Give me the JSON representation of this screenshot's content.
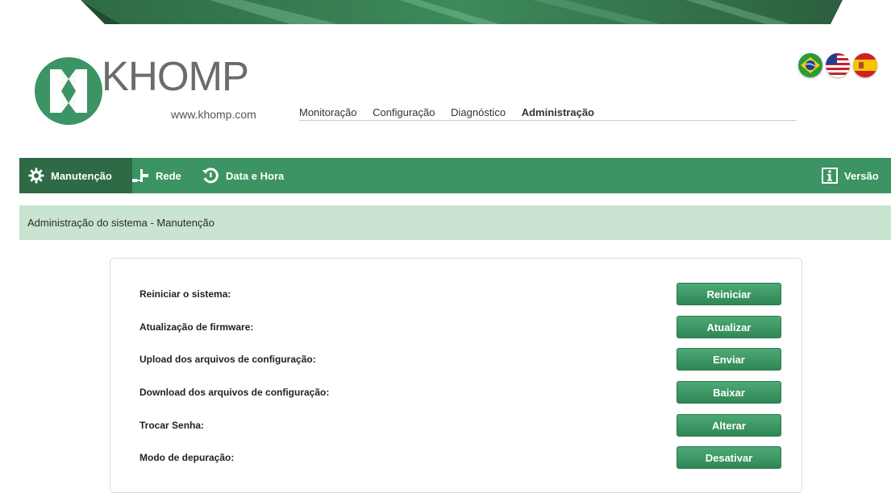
{
  "brand": {
    "name": "KHOMP",
    "url": "www.khomp.com"
  },
  "topnav": [
    {
      "label": "Monitoração",
      "active": false
    },
    {
      "label": "Configuração",
      "active": false
    },
    {
      "label": "Diagnóstico",
      "active": false
    },
    {
      "label": "Administração",
      "active": true
    }
  ],
  "languages": [
    "brazil-flag-icon",
    "usa-flag-icon",
    "spain-flag-icon"
  ],
  "menubar": {
    "items": [
      {
        "label": "Manutenção",
        "icon": "gear-icon",
        "active": true
      },
      {
        "label": "Rede",
        "icon": "network-icon",
        "active": false
      },
      {
        "label": "Data e Hora",
        "icon": "history-clock-icon",
        "active": false
      }
    ],
    "version": {
      "label": "Versão",
      "icon": "info-icon"
    }
  },
  "page_title": "Administração do sistema - Manutenção",
  "actions": [
    {
      "label": "Reiniciar o sistema:",
      "button": "Reiniciar"
    },
    {
      "label": "Atualização de firmware:",
      "button": "Atualizar"
    },
    {
      "label": "Upload dos arquivos de configuração:",
      "button": "Enviar"
    },
    {
      "label": "Download dos arquivos de configuração:",
      "button": "Baixar"
    },
    {
      "label": "Trocar Senha:",
      "button": "Alterar"
    },
    {
      "label": "Modo de depuração:",
      "button": "Desativar"
    }
  ],
  "colors": {
    "primary_green": "#3c9363",
    "active_menu": "#2d6a45",
    "subheader_bg": "#c9e4d1",
    "button_green": "#2f8756"
  }
}
